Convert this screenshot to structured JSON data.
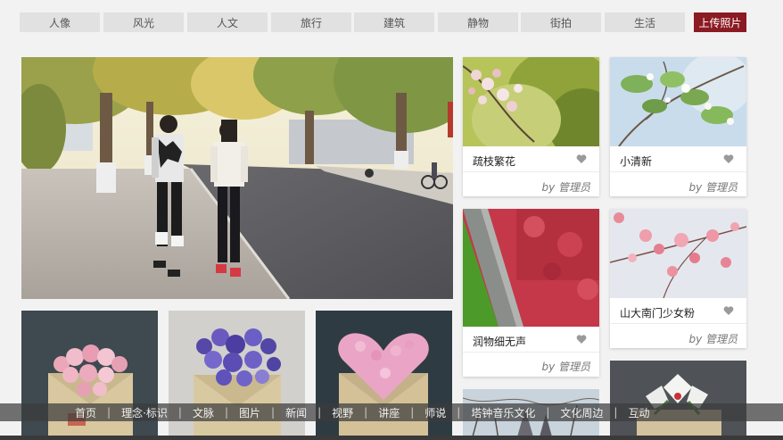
{
  "categories": [
    "人像",
    "风光",
    "人文",
    "旅行",
    "建筑",
    "静物",
    "街拍",
    "生活"
  ],
  "upload_label": "上传照片",
  "cards": [
    {
      "title": "疏枝繁花",
      "author": "by 管理员"
    },
    {
      "title": "小清新",
      "author": "by 管理员"
    },
    {
      "title": "润物细无声",
      "author": "by 管理员"
    },
    {
      "title": "山大南门少女粉",
      "author": "by 管理员"
    }
  ],
  "bottom_nav": [
    "首页",
    "理念·标识",
    "文脉",
    "图片",
    "新闻",
    "视野",
    "讲座",
    "师说",
    "塔钟音乐文化",
    "文化周边",
    "互动"
  ],
  "colors": {
    "accent": "#8b1a22",
    "background": "#f3f2f3",
    "tab": "#e2e1e2"
  },
  "icons": {
    "like": "heart-icon"
  }
}
